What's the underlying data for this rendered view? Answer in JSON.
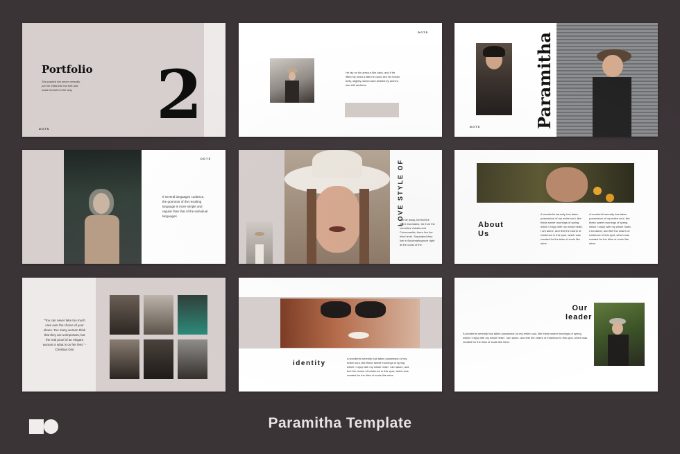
{
  "colors": {
    "background": "#3b3437",
    "beige": "#d6cdcb",
    "slide": "#ffffff",
    "text": "#111111"
  },
  "footer": {
    "title": "Paramitha Template"
  },
  "slides": {
    "s1": {
      "title": "Portfolio",
      "number": "2",
      "body": "She packed her seven versalia, put her initial into the belt and made herself on the way.",
      "dots": "DOTS"
    },
    "s2": {
      "dots": "DOTS",
      "body": "He lay on his armour-like back, and if he lifted his head a little he could see his brown belly, slightly domed and divided by arches into stiff sections."
    },
    "s3": {
      "title": "Paramitha",
      "dots": "DOTS"
    },
    "s4": {
      "dots": "DOTS",
      "body": "If several languages coalesce, the grammar of the resulting language is more simple and regular than that of the individual languages."
    },
    "s5": {
      "title_line1": "STYLE OF",
      "title_line2": "LOVE",
      "body": "Far far away, behind the word mountains, far from the countries Vokalia and Consonantia, there live the blind texts. Separated they live in Bookmarksgrove right at the coast of the"
    },
    "s6": {
      "title_line1": "About",
      "title_line2": "Us",
      "body1": "A wonderful serenity has taken possession of my entire soul, like these sweet mornings of spring which I enjoy with my whole heart. I am alone, and feel the charm of existence in this spot, which was created for the bliss of souls like mine.",
      "body2": "A wonderful serenity has taken possession of my entire soul, like these sweet mornings of spring which I enjoy with my whole heart. I am alone, and feel the charm of existence in this spot, which was created for the bliss of souls like mine."
    },
    "s7": {
      "quote": "\"You can never take too much care over the choice of your shoes. Too many women think that they are unimportant, but the real proof of an elegant woman is what is on her feet.\" - Christian Dior"
    },
    "s8": {
      "title": "identity",
      "body": "A wonderful serenity has taken possession of my entire soul, like these sweet mornings of spring which I enjoy with my whole heart. I am alone, and feel the charm of existence in this spot, which was created for the bliss of souls like mine."
    },
    "s9": {
      "title_line1": "Our",
      "title_line2": "leader",
      "body": "A wonderful serenity has taken possession of my entire soul, like these sweet mornings of spring which I enjoy with my whole heart. I am alone, and feel the charm of existence in this spot, which was created for the bliss of souls like mine."
    }
  }
}
